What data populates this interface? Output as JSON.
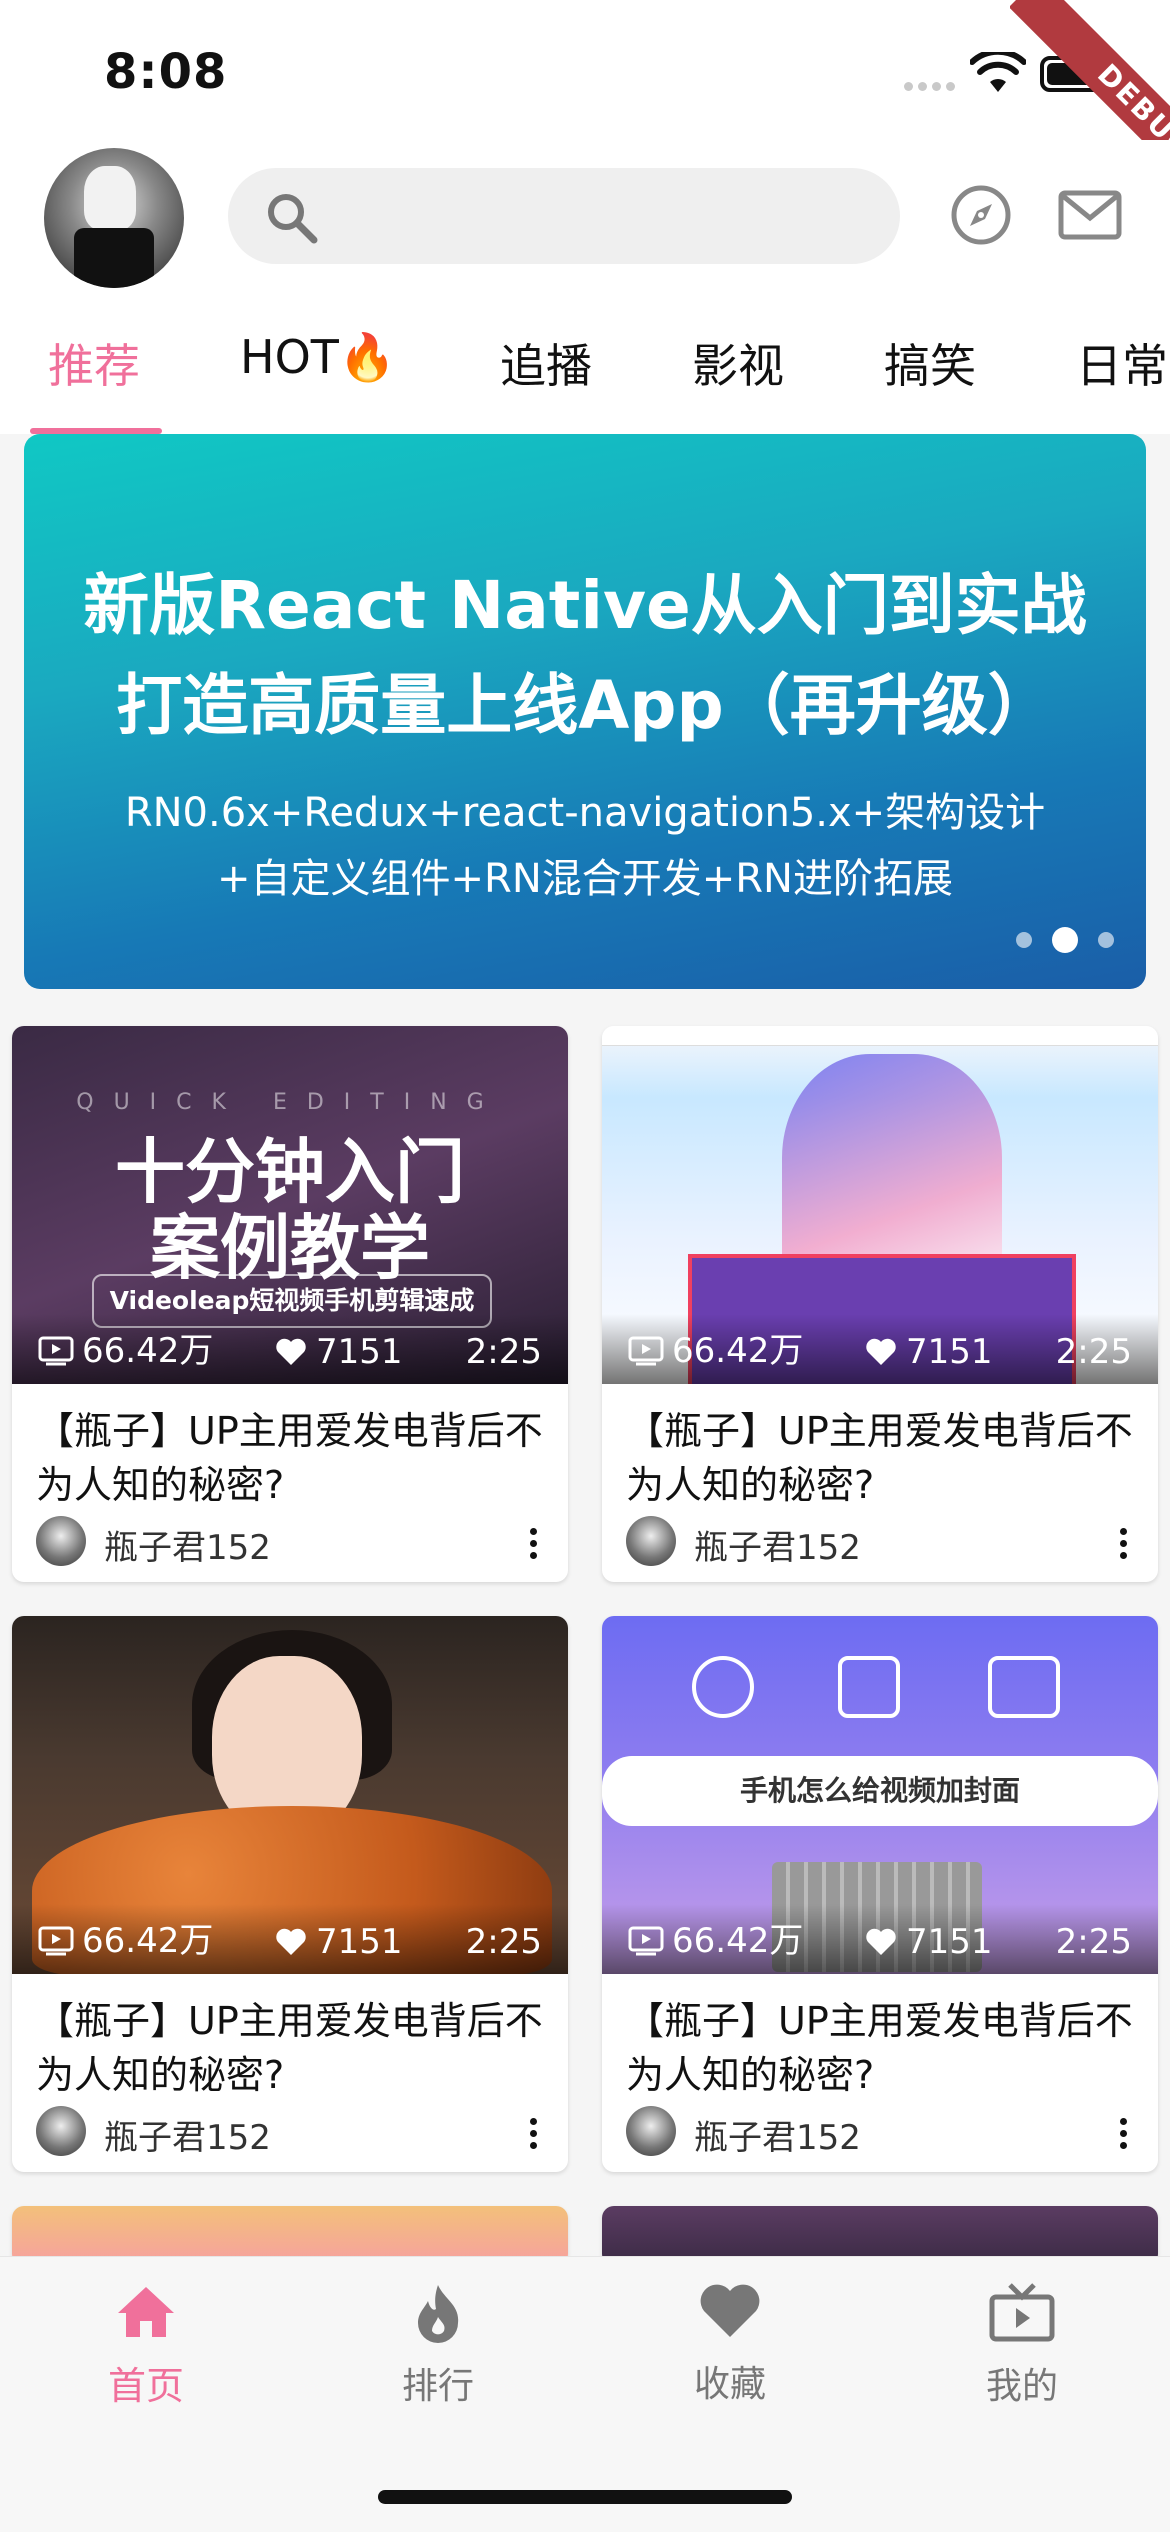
{
  "status_bar": {
    "time": "8:08"
  },
  "debug_banner": "DEBUG",
  "tabs": [
    "推荐",
    "HOT🔥",
    "追播",
    "影视",
    "搞笑",
    "日常"
  ],
  "banner": {
    "line1": "新版React Native从入门到实战",
    "line2": "打造高质量上线App（再升级）",
    "line3": "RN0.6x+Redux+react-navigation5.x+架构设计",
    "line4": "+自定义组件+RN混合开发+RN进阶拓展",
    "page_count": 3,
    "active_page": 2
  },
  "thumb_art": {
    "card1_subtitle": "QUICK EDITING",
    "card1_big1": "十分钟入门",
    "card1_big2": "案例教学",
    "card1_pill": "Videoleap短视频手机剪辑速成",
    "card4_bar": "手机怎么给视频加封面"
  },
  "videos": [
    {
      "views": "66.42万",
      "likes": "7151",
      "duration": "2:25",
      "title": "【瓶子】UP主用爱发电背后不为人知的秘密?",
      "owner": "瓶子君152"
    },
    {
      "views": "66.42万",
      "likes": "7151",
      "duration": "2:25",
      "title": "【瓶子】UP主用爱发电背后不为人知的秘密?",
      "owner": "瓶子君152"
    },
    {
      "views": "66.42万",
      "likes": "7151",
      "duration": "2:25",
      "title": "【瓶子】UP主用爱发电背后不为人知的秘密?",
      "owner": "瓶子君152"
    },
    {
      "views": "66.42万",
      "likes": "7151",
      "duration": "2:25",
      "title": "【瓶子】UP主用爱发电背后不为人知的秘密?",
      "owner": "瓶子君152"
    }
  ],
  "bottom_nav": [
    {
      "label": "首页",
      "icon": "home-icon",
      "active": true
    },
    {
      "label": "排行",
      "icon": "flame-icon"
    },
    {
      "label": "收藏",
      "icon": "heart-icon"
    },
    {
      "label": "我的",
      "icon": "tv-icon"
    }
  ],
  "colors": {
    "accent": "#f0709b",
    "banner_start": "#10c8c4",
    "banner_end": "#1a5ea8"
  }
}
